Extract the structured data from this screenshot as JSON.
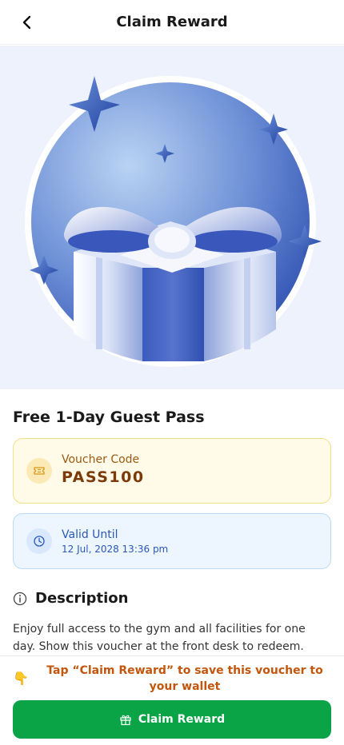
{
  "header": {
    "title": "Claim Reward",
    "back_icon": "chevron-left-icon"
  },
  "reward": {
    "title": "Free 1-Day Guest Pass",
    "image": "gift-box-illustration"
  },
  "voucher": {
    "label": "Voucher Code",
    "code": "PASS100",
    "icon": "ticket-icon"
  },
  "validity": {
    "label": "Valid Until",
    "date": "12 Jul, 2028 13:36 pm",
    "icon": "clock-icon"
  },
  "description": {
    "heading": "Description",
    "icon": "info-icon",
    "body": "Enjoy full access to the gym and all facilities for one day. Show this voucher at the front desk to redeem."
  },
  "footer": {
    "hint_icon": "👇",
    "hint_text": "Tap “Claim Reward” to save this voucher to your wallet",
    "button_label": "Claim Reward",
    "button_icon": "gift-icon"
  },
  "colors": {
    "primary_green": "#0aa447",
    "voucher_bg": "#fffbe8",
    "valid_bg": "#edf6fe",
    "hero_bg": "#edf2fd",
    "hint_orange": "#c2560c"
  }
}
